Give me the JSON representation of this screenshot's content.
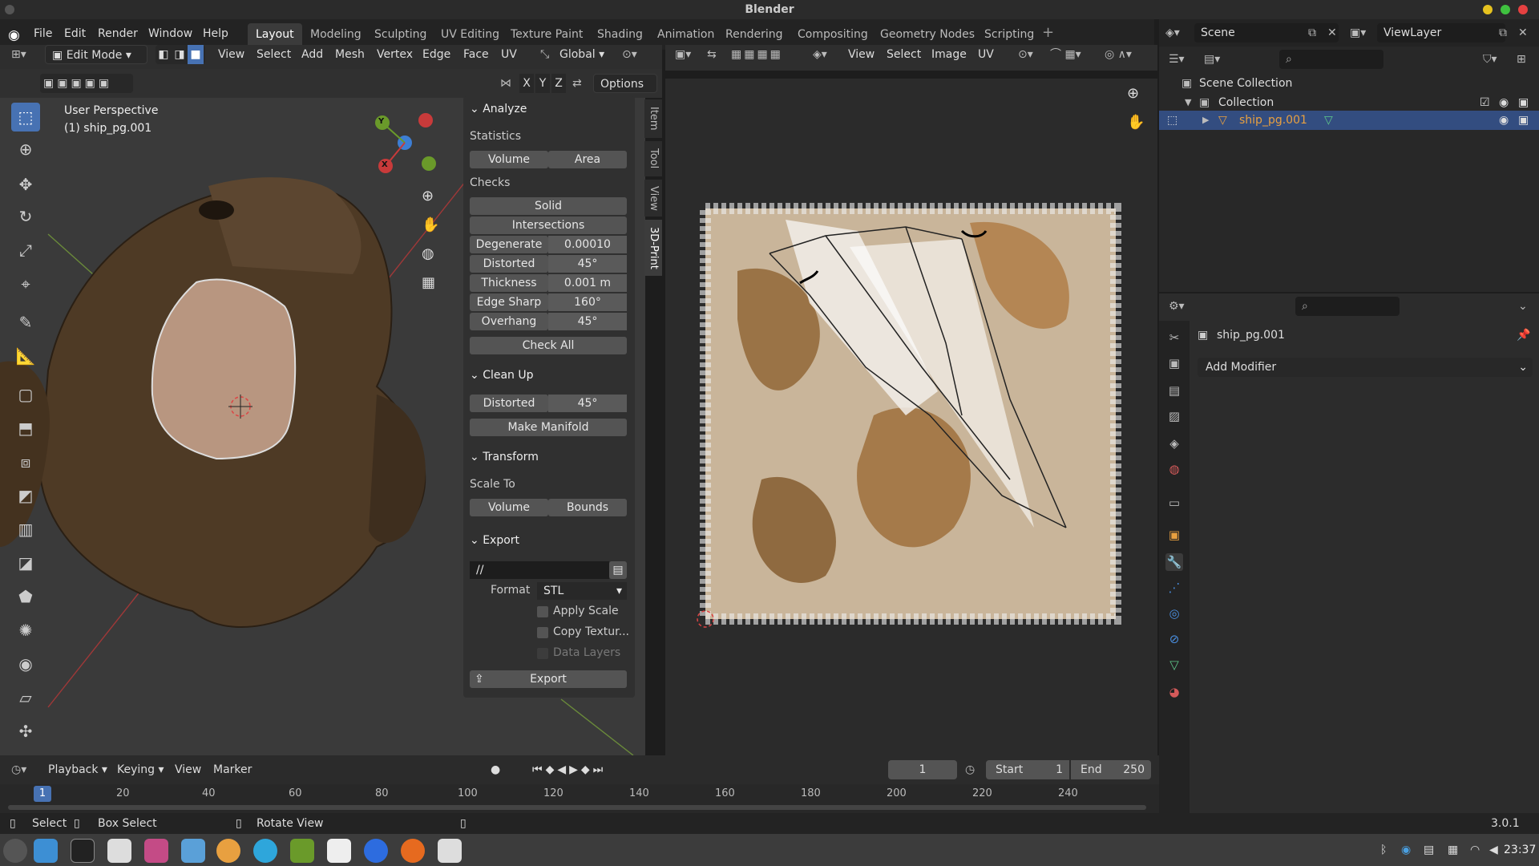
{
  "window": {
    "title": "Blender"
  },
  "menu": {
    "items": [
      "File",
      "Edit",
      "Render",
      "Window",
      "Help"
    ]
  },
  "workspaces": [
    "Layout",
    "Modeling",
    "Sculpting",
    "UV Editing",
    "Texture Paint",
    "Shading",
    "Animation",
    "Rendering",
    "Compositing",
    "Geometry Nodes",
    "Scripting"
  ],
  "top_right": {
    "scene": "Scene",
    "view_layer": "ViewLayer"
  },
  "viewport": {
    "mode": "Edit Mode",
    "menus": [
      "View",
      "Select",
      "Add",
      "Mesh",
      "Vertex",
      "Edge",
      "Face",
      "UV"
    ],
    "orientation": "Global",
    "options": "Options",
    "perspective": "User Perspective",
    "object": "(1) ship_pg.001",
    "axes": [
      "X",
      "Y",
      "Z"
    ]
  },
  "npanel": {
    "analyze": "Analyze",
    "statistics": "Statistics",
    "volume": "Volume",
    "area": "Area",
    "checks": "Checks",
    "solid": "Solid",
    "intersections": "Intersections",
    "rows": [
      {
        "label": "Degenerate",
        "value": "0.00010"
      },
      {
        "label": "Distorted",
        "value": "45°"
      },
      {
        "label": "Thickness",
        "value": "0.001 m"
      },
      {
        "label": "Edge Sharp",
        "value": "160°"
      },
      {
        "label": "Overhang",
        "value": "45°"
      }
    ],
    "check_all": "Check All",
    "cleanup": "Clean Up",
    "cleanup_distorted": "Distorted",
    "cleanup_distorted_val": "45°",
    "make_manifold": "Make Manifold",
    "transform": "Transform",
    "scale_to": "Scale To",
    "bounds": "Bounds",
    "export": "Export",
    "path": "//",
    "format_label": "Format",
    "format": "STL",
    "apply_scale": "Apply Scale",
    "copy_textures": "Copy Textur...",
    "data_layers": "Data Layers",
    "export_btn": "Export",
    "tabs": [
      "Item",
      "Tool",
      "View",
      "3D-Print"
    ]
  },
  "uv": {
    "menus": [
      "View",
      "Select",
      "Image",
      "UV"
    ]
  },
  "outliner": {
    "scene_collection": "Scene Collection",
    "collection": "Collection",
    "object": "ship_pg.001"
  },
  "properties": {
    "object": "ship_pg.001",
    "add_modifier": "Add Modifier"
  },
  "timeline": {
    "menus": [
      "Playback",
      "Keying",
      "View",
      "Marker"
    ],
    "current": "1",
    "start_label": "Start",
    "start": "1",
    "end_label": "End",
    "end": "250",
    "ticks": [
      "1",
      "20",
      "40",
      "60",
      "80",
      "100",
      "120",
      "140",
      "160",
      "180",
      "200",
      "220",
      "240"
    ]
  },
  "status": {
    "select": "Select",
    "box_select": "Box Select",
    "rotate": "Rotate View",
    "version": "3.0.1"
  },
  "taskbar": {
    "time": "23:37"
  },
  "colors": {
    "accent": "#4772b3",
    "orange": "#e8a040"
  }
}
